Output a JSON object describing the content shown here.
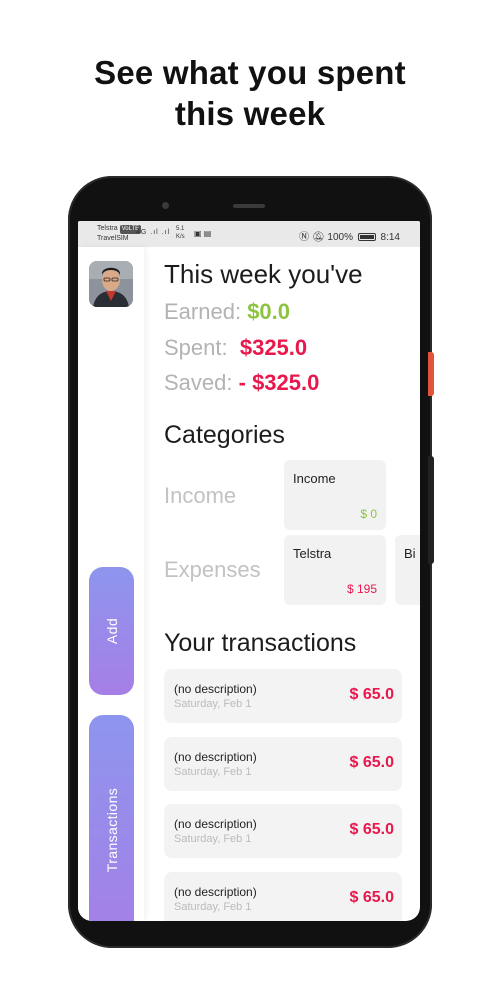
{
  "headline": {
    "line1": "See what you spent",
    "line2": "this week"
  },
  "status_bar": {
    "carrier": "Telstra",
    "carrier_badge": "VoLTE",
    "carrier_sub": "TravelSIM",
    "signal_text": "4G .ıl  .ıl",
    "speed_value": "5.1",
    "speed_unit": "K/s",
    "battery_percent": "100%",
    "time": "8:14"
  },
  "rail": {
    "add_label": "Add",
    "transactions_label": "Transactions"
  },
  "summary": {
    "title": "This week you've",
    "earned_label": "Earned:",
    "earned_value": "$0.0",
    "spent_label": "Spent:",
    "spent_value": "$325.0",
    "saved_label": "Saved:",
    "saved_value": "- $325.0"
  },
  "categories": {
    "title": "Categories",
    "income_row_label": "Income",
    "expenses_row_label": "Expenses",
    "income_cards": [
      {
        "name": "Income",
        "amount": "$ 0"
      }
    ],
    "expense_cards": [
      {
        "name": "Telstra",
        "amount": "$ 195"
      },
      {
        "name": "Bi",
        "amount": ""
      }
    ]
  },
  "transactions": {
    "title": "Your transactions",
    "items": [
      {
        "description": "(no description)",
        "date": "Saturday, Feb 1",
        "amount": "$ 65.0"
      },
      {
        "description": "(no description)",
        "date": "Saturday, Feb 1",
        "amount": "$ 65.0"
      },
      {
        "description": "(no description)",
        "date": "Saturday, Feb 1",
        "amount": "$ 65.0"
      },
      {
        "description": "(no description)",
        "date": "Saturday, Feb 1",
        "amount": "$ 65.0"
      }
    ]
  },
  "colors": {
    "accent_purple": "#9a8aea",
    "positive_green": "#8dc43f",
    "negative_red": "#e8184c",
    "muted_label": "#b3b3b3"
  }
}
